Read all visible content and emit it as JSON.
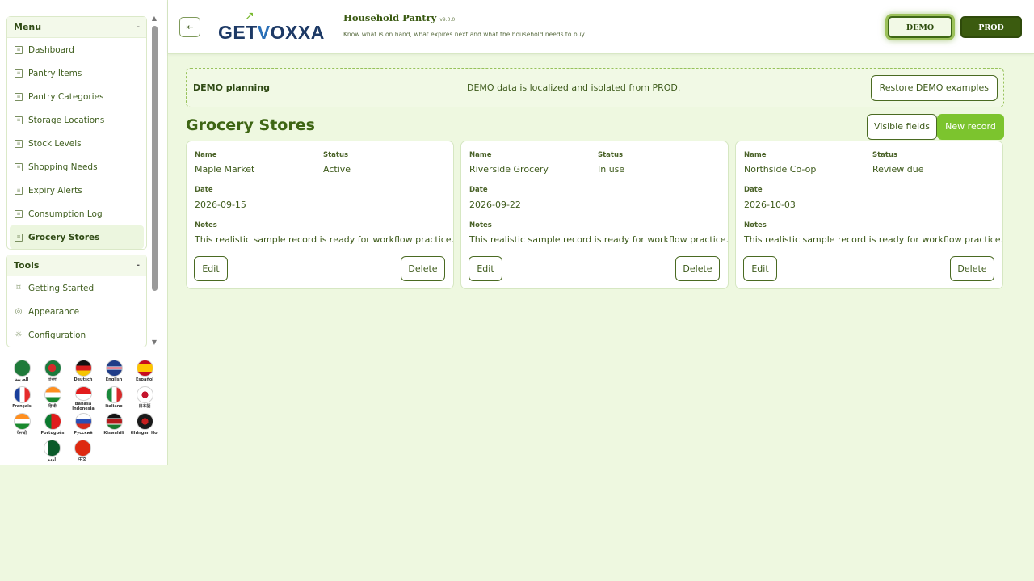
{
  "sidebar": {
    "menu_title": "Menu",
    "menu_toggle": "-",
    "menu_items": [
      {
        "label": "Dashboard"
      },
      {
        "label": "Pantry Items"
      },
      {
        "label": "Pantry Categories"
      },
      {
        "label": "Storage Locations"
      },
      {
        "label": "Stock Levels"
      },
      {
        "label": "Shopping Needs"
      },
      {
        "label": "Expiry Alerts"
      },
      {
        "label": "Consumption Log"
      },
      {
        "label": "Grocery Stores"
      }
    ],
    "active_item": "Grocery Stores",
    "tools_title": "Tools",
    "tools_toggle": "-",
    "tools_items": [
      {
        "label": "Getting Started",
        "icon": "bookmark-icon"
      },
      {
        "label": "Appearance",
        "icon": "palette-icon"
      },
      {
        "label": "Configuration",
        "icon": "gear-icon"
      }
    ],
    "languages": [
      {
        "label": "العربية",
        "icon": "flag-saudi-arabia-icon"
      },
      {
        "label": "বাংলা",
        "icon": "flag-bangladesh-icon"
      },
      {
        "label": "Deutsch",
        "icon": "flag-germany-icon"
      },
      {
        "label": "English",
        "icon": "flag-uk-icon"
      },
      {
        "label": "Español",
        "icon": "flag-spain-icon"
      },
      {
        "label": "Français",
        "icon": "flag-france-icon"
      },
      {
        "label": "हिन्दी",
        "icon": "flag-india-icon"
      },
      {
        "label": "Bahasa Indonesia",
        "icon": "flag-indonesia-icon"
      },
      {
        "label": "Italiano",
        "icon": "flag-italy-icon"
      },
      {
        "label": "日本語",
        "icon": "flag-japan-icon"
      },
      {
        "label": "ਪੰਜਾਬੀ",
        "icon": "flag-india-icon"
      },
      {
        "label": "Português",
        "icon": "flag-portugal-icon"
      },
      {
        "label": "Русский",
        "icon": "flag-russia-icon"
      },
      {
        "label": "Kiswahili",
        "icon": "flag-kenya-icon"
      },
      {
        "label": "tlhIngan Hol",
        "icon": "flag-klingon-icon"
      },
      {
        "label": "اردو",
        "icon": "flag-pakistan-icon"
      },
      {
        "label": "中文",
        "icon": "flag-china-icon"
      }
    ]
  },
  "header": {
    "collapse_icon": "collapse-sidebar-icon",
    "logo_text_a": "GET",
    "logo_text_b": "V",
    "logo_text_c": "OXXA",
    "app_title": "Household Pantry",
    "version": "v9.0.0",
    "subtitle": "Know what is on hand, what expires next and what the household needs to buy",
    "demo_label": "DEMO",
    "prod_label": "PROD"
  },
  "notice": {
    "title": "DEMO planning",
    "text": "DEMO data is localized and isolated from PROD.",
    "restore_label": "Restore DEMO examples"
  },
  "main": {
    "page_title": "Grocery Stores",
    "visible_fields_label": "Visible fields",
    "new_record_label": "New record",
    "field_labels": {
      "name": "Name",
      "status": "Status",
      "date": "Date",
      "notes": "Notes"
    },
    "edit_label": "Edit",
    "delete_label": "Delete",
    "records": [
      {
        "name": "Maple Market",
        "status": "Active",
        "date": "2026-09-15",
        "notes": "This realistic sample record is ready for workflow practice."
      },
      {
        "name": "Riverside Grocery",
        "status": "In use",
        "date": "2026-09-22",
        "notes": "This realistic sample record is ready for workflow practice."
      },
      {
        "name": "Northside Co-op",
        "status": "Review due",
        "date": "2026-10-03",
        "notes": "This realistic sample record is ready for workflow practice."
      }
    ]
  },
  "colors": {
    "accent": "#7cc42e",
    "dark_green": "#3b5b0f",
    "background": "#eef8e0"
  }
}
